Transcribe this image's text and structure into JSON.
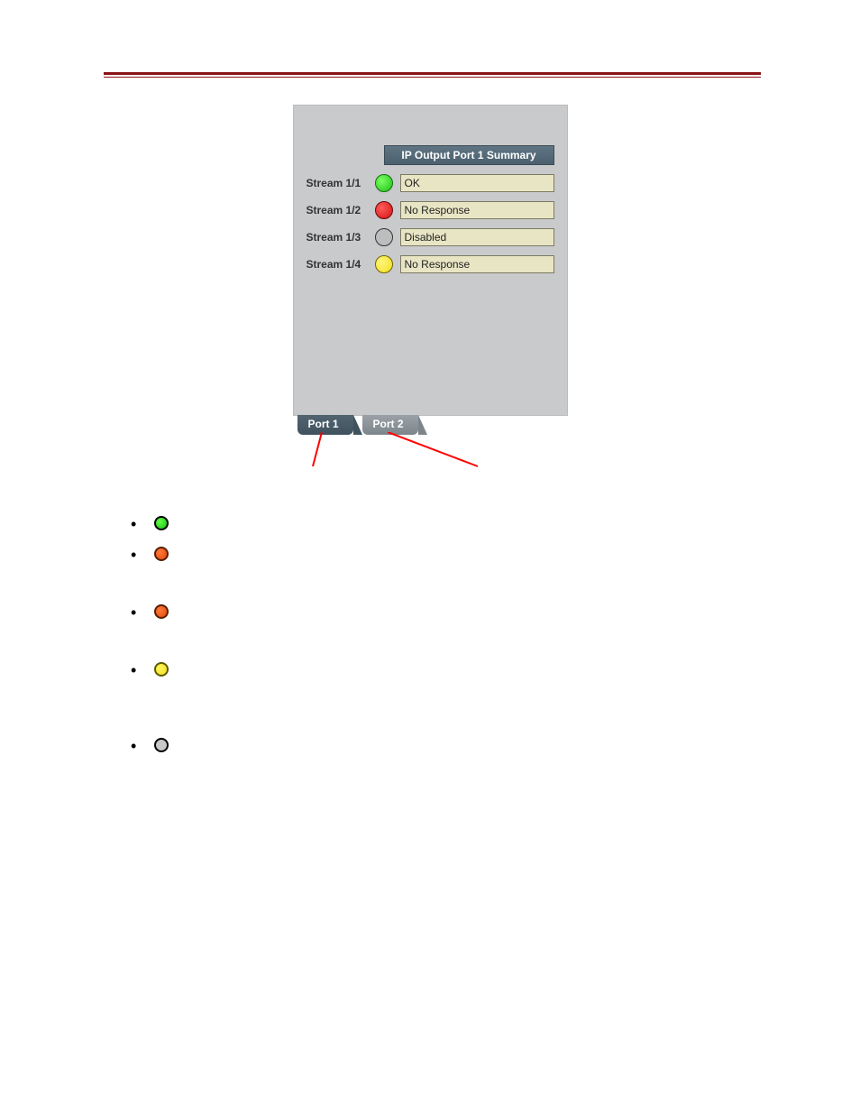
{
  "panel": {
    "header": "IP Output Port 1 Summary",
    "streams": [
      {
        "label": "Stream 1/1",
        "dot": "green",
        "status": "OK"
      },
      {
        "label": "Stream 1/2",
        "dot": "red",
        "status": "No Response"
      },
      {
        "label": "Stream 1/3",
        "dot": "gray",
        "status": "Disabled"
      },
      {
        "label": "Stream 1/4",
        "dot": "yellow",
        "status": "No Response"
      }
    ],
    "tabs": [
      {
        "label": "Port 1",
        "active": true
      },
      {
        "label": "Port 2",
        "active": false
      }
    ]
  },
  "legend": [
    {
      "dot": "green"
    },
    {
      "dot": "orange"
    },
    {
      "dot": "orange"
    },
    {
      "dot": "yellow"
    },
    {
      "dot": "gray"
    }
  ]
}
